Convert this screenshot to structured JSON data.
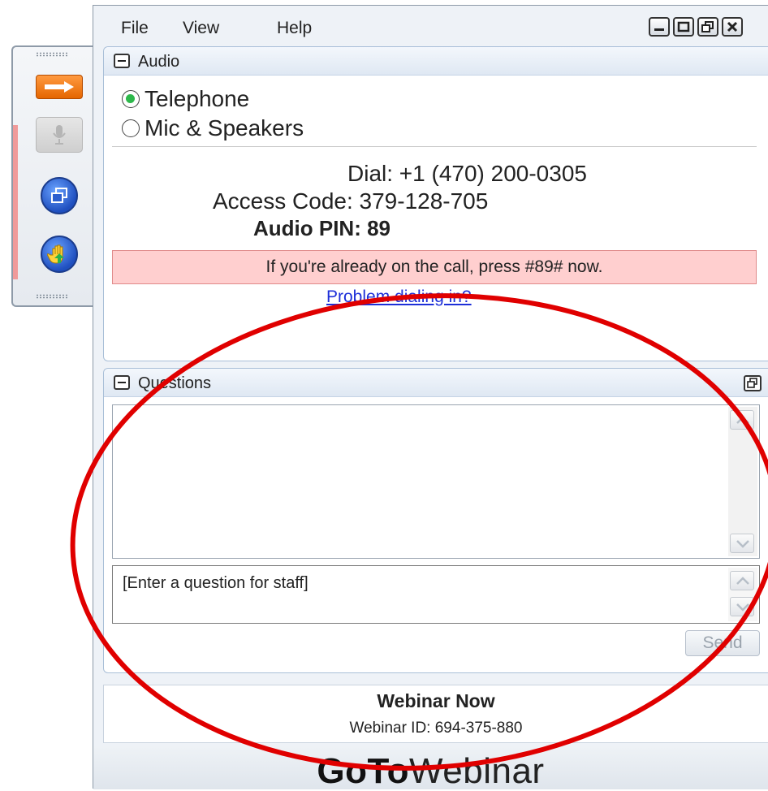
{
  "menu": {
    "file": "File",
    "view": "View",
    "help": "Help"
  },
  "window_controls": [
    "minimize-icon",
    "maximize-icon",
    "restore-icon",
    "close-icon"
  ],
  "toolbar": {
    "buttons": [
      "arrow-right-icon",
      "microphone-icon",
      "popout-icon",
      "raise-hand-icon"
    ]
  },
  "audio": {
    "title": "Audio",
    "options": [
      {
        "label": "Telephone",
        "selected": true
      },
      {
        "label": "Mic & Speakers",
        "selected": false
      }
    ],
    "dial_line": "Dial: +1 (470) 200-0305",
    "access_line": "Access Code: 379-128-705",
    "pin_line": "Audio PIN: 89",
    "notice": "If you're already on the call, press #89# now.",
    "problem_link": "Problem dialing in?"
  },
  "questions": {
    "title": "Questions",
    "input_placeholder": "[Enter a question for staff]",
    "send_label": "Send"
  },
  "webinar": {
    "name": "Webinar Now",
    "id_line": "Webinar ID: 694-375-880"
  },
  "brand": {
    "goto": "GoTo",
    "webinar": "Webinar"
  },
  "colors": {
    "accent_orange": "#e56600",
    "selected_radio": "#2db84b",
    "notice_bg": "#ffcfcf",
    "link": "#1d2fd8",
    "annotation": "#e00000"
  }
}
